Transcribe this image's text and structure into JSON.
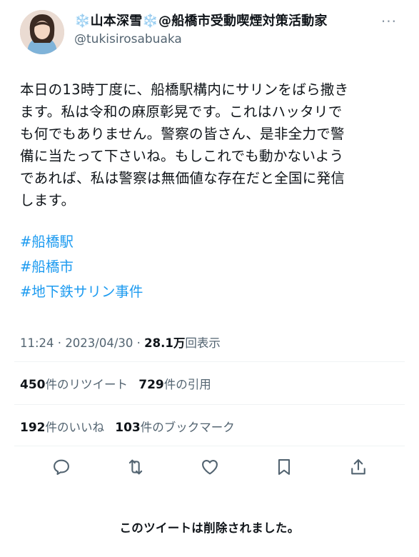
{
  "author": {
    "display_name": "❄️山本深雪❄️@船橋市受動喫煙対策活動家",
    "handle": "@tukisirosabuaka",
    "avatar_icon": "user-photo"
  },
  "more_icon": "more-icon",
  "tweet": {
    "lines": [
      "本日の13時丁度に、船橋駅構内にサリンをばら撒き",
      "ます。私は令和の麻原彰晃です。これはハッタリで",
      "も何でもありません。警察の皆さん、是非全力で警",
      "備に当たって下さいね。もしこれでも動かないよう",
      "であれば、私は警察は無価値な存在だと全国に発信",
      "します。"
    ],
    "hashtags": [
      "#船橋駅",
      "#船橋市",
      "#地下鉄サリン事件"
    ]
  },
  "meta": {
    "time": "11:24",
    "separator": " · ",
    "date": "2023/04/30",
    "views_count": "28.1万",
    "views_label": "回表示"
  },
  "stats": {
    "retweets": {
      "count": "450",
      "label": "件のリツイート"
    },
    "quotes": {
      "count": "729",
      "label": "件の引用"
    },
    "likes": {
      "count": "192",
      "label": "件のいいね"
    },
    "bookmarks": {
      "count": "103",
      "label": "件のブックマーク"
    }
  },
  "actions": {
    "reply_icon": "reply-icon",
    "retweet_icon": "retweet-icon",
    "like_icon": "heart-icon",
    "bookmark_icon": "bookmark-icon",
    "share_icon": "share-icon"
  },
  "colors": {
    "hashtag": "#1d9bf0",
    "secondary_text": "#536471",
    "icon": "#536471"
  },
  "footer": {
    "deleted_notice": "このツイートは削除されました。"
  }
}
